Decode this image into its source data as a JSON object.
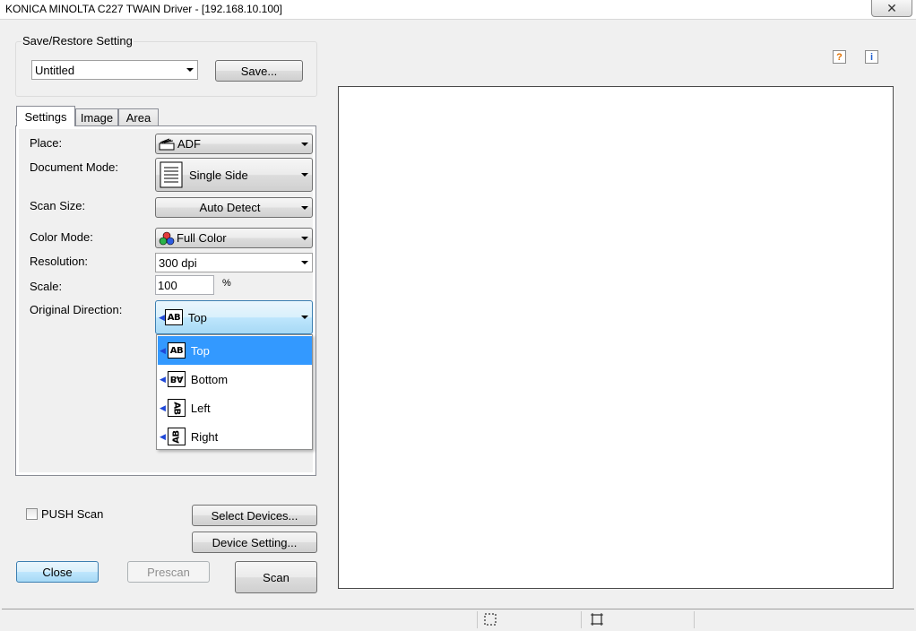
{
  "window": {
    "title": "KONICA MINOLTA C227 TWAIN Driver - [192.168.10.100]",
    "close_glyph": "✕"
  },
  "save_restore": {
    "group_label": "Save/Restore Setting",
    "selected": "Untitled",
    "save_button": "Save..."
  },
  "tabs": [
    {
      "label": "Settings",
      "active": true
    },
    {
      "label": "Image",
      "active": false
    },
    {
      "label": "Area",
      "active": false
    }
  ],
  "settings": {
    "place": {
      "label": "Place:",
      "value": "ADF",
      "icon": "adf-icon"
    },
    "document_mode": {
      "label": "Document Mode:",
      "value": "Single Side",
      "icon": "single-side-icon"
    },
    "scan_size": {
      "label": "Scan Size:",
      "value": "Auto Detect"
    },
    "color_mode": {
      "label": "Color Mode:",
      "value": "Full Color",
      "icon": "rgb-circles-icon"
    },
    "resolution": {
      "label": "Resolution:",
      "value": "300 dpi"
    },
    "scale": {
      "label": "Scale:",
      "value": "100",
      "unit": "%"
    },
    "original_direction": {
      "label": "Original Direction:",
      "value": "Top",
      "icon_text": "AB",
      "options": [
        {
          "label": "Top",
          "icon_text": "AB",
          "selected": true
        },
        {
          "label": "Bottom",
          "icon_text": "BA",
          "selected": false
        },
        {
          "label": "Left",
          "icon_text": "AB",
          "selected": false
        },
        {
          "label": "Right",
          "icon_text": "AB",
          "selected": false
        }
      ]
    }
  },
  "push_scan": {
    "label": "PUSH Scan",
    "checked": false
  },
  "buttons": {
    "select_devices": "Select Devices...",
    "device_setting": "Device Setting...",
    "close": "Close",
    "prescan": "Prescan",
    "scan": "Scan"
  },
  "help": {
    "question_glyph": "?",
    "info_glyph": "i"
  },
  "colors": {
    "selection": "#3399ff",
    "focus_border": "#3c7fb1",
    "help_icon": "#e07000",
    "info_icon": "#1f5fcf"
  }
}
